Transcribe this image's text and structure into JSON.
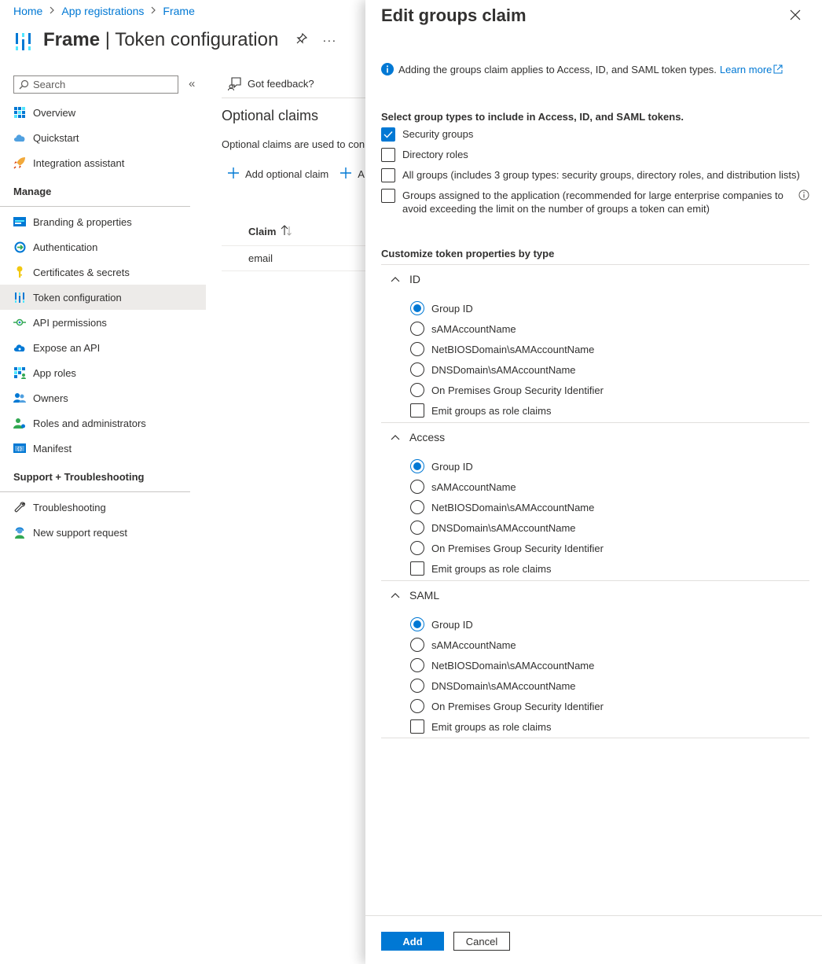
{
  "breadcrumb": {
    "home": "Home",
    "app_registrations": "App registrations",
    "frame": "Frame",
    "separator": ">"
  },
  "header": {
    "app_name": "Frame",
    "divider": "|",
    "page_name": "Token configuration",
    "more": "···"
  },
  "search": {
    "placeholder": "Search"
  },
  "nav": {
    "collapse": "«",
    "top_items": [
      {
        "label": "Overview",
        "icon": "overview-icon"
      },
      {
        "label": "Quickstart",
        "icon": "quickstart-cloud-icon"
      },
      {
        "label": "Integration assistant",
        "icon": "rocket-icon"
      }
    ],
    "manage_header": "Manage",
    "manage_items": [
      {
        "label": "Branding & properties",
        "icon": "branding-icon"
      },
      {
        "label": "Authentication",
        "icon": "authentication-icon"
      },
      {
        "label": "Certificates & secrets",
        "icon": "key-icon"
      },
      {
        "label": "Token configuration",
        "icon": "token-bars-icon",
        "active": true
      },
      {
        "label": "API permissions",
        "icon": "api-permissions-icon"
      },
      {
        "label": "Expose an API",
        "icon": "cloud-api-icon"
      },
      {
        "label": "App roles",
        "icon": "app-roles-icon"
      },
      {
        "label": "Owners",
        "icon": "owners-icon"
      },
      {
        "label": "Roles and administrators",
        "icon": "roles-admins-icon"
      },
      {
        "label": "Manifest",
        "icon": "manifest-icon"
      }
    ],
    "support_header": "Support + Troubleshooting",
    "support_items": [
      {
        "label": "Troubleshooting",
        "icon": "wrench-icon"
      },
      {
        "label": "New support request",
        "icon": "support-person-icon"
      }
    ]
  },
  "main": {
    "feedback": "Got feedback?",
    "section_title": "Optional claims",
    "section_desc": "Optional claims are used to con",
    "add_optional_claim": "Add optional claim",
    "add_groups_claim_fragment": "A",
    "grid_header": "Claim",
    "grid_row": "email"
  },
  "panel": {
    "title": "Edit groups claim",
    "info_text": "Adding the groups claim applies to Access, ID, and SAML token types.",
    "learn_more": "Learn more",
    "select_title": "Select group types to include in Access, ID, and SAML tokens.",
    "group_types": [
      {
        "label": "Security groups",
        "checked": true
      },
      {
        "label": "Directory roles",
        "checked": false
      },
      {
        "label": "All groups (includes 3 group types: security groups, directory roles, and distribution lists)",
        "checked": false
      },
      {
        "label": "Groups assigned to the application (recommended for large enterprise companies to avoid exceeding the limit on the number of groups a token can emit)",
        "checked": false,
        "info": true
      }
    ],
    "customize_title": "Customize token properties by type",
    "sections": [
      {
        "name": "ID",
        "options": [
          "Group ID",
          "sAMAccountName",
          "NetBIOSDomain\\sAMAccountName",
          "DNSDomain\\sAMAccountName",
          "On Premises Group Security Identifier"
        ],
        "selected": 0,
        "role_claims_label": "Emit groups as role claims",
        "role_claims": false
      },
      {
        "name": "Access",
        "options": [
          "Group ID",
          "sAMAccountName",
          "NetBIOSDomain\\sAMAccountName",
          "DNSDomain\\sAMAccountName",
          "On Premises Group Security Identifier"
        ],
        "selected": 0,
        "role_claims_label": "Emit groups as role claims",
        "role_claims": false
      },
      {
        "name": "SAML",
        "options": [
          "Group ID",
          "sAMAccountName",
          "NetBIOSDomain\\sAMAccountName",
          "DNSDomain\\sAMAccountName",
          "On Premises Group Security Identifier"
        ],
        "selected": 0,
        "role_claims_label": "Emit groups as role claims",
        "role_claims": false
      }
    ],
    "add_button": "Add",
    "cancel_button": "Cancel"
  },
  "colors": {
    "accent": "#0078d4",
    "text": "#323130",
    "nav_active": "#edebe9",
    "border": "#e1dfdd"
  }
}
